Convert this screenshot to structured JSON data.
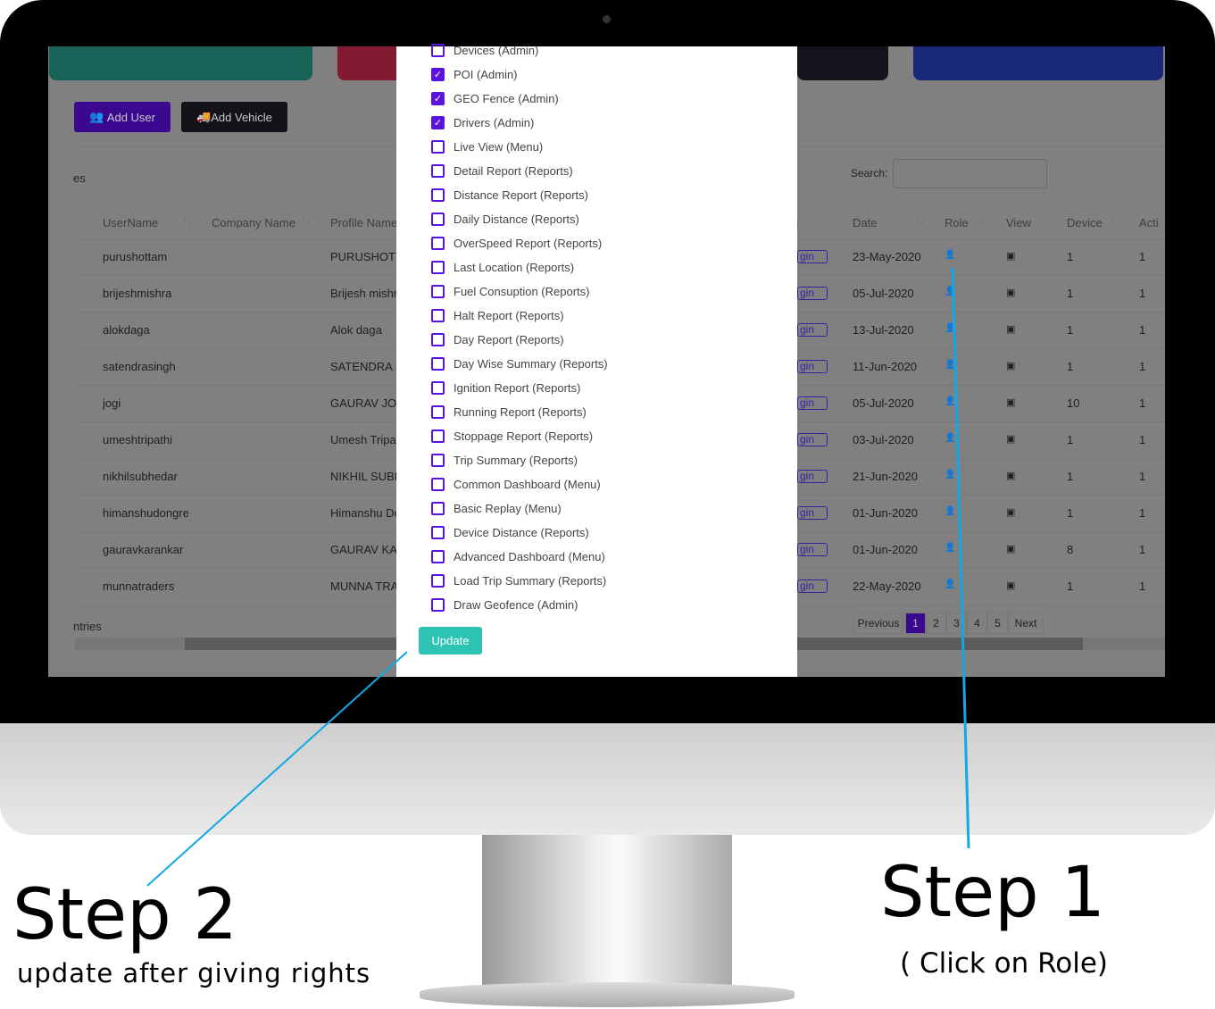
{
  "actions": {
    "add_user": "Add User",
    "add_vehicle": "Add Vehicle"
  },
  "table": {
    "entries_fragment_top": "es",
    "entries_fragment_bottom": "ntries",
    "search_label": "Search:",
    "search_value": "",
    "columns": [
      "UserName",
      "Company Name",
      "Profile Name",
      "n",
      "Date",
      "Role",
      "View",
      "Device",
      "Acti"
    ],
    "rows": [
      {
        "user": "purushottam",
        "company": "",
        "profile": "PURUSHOTT",
        "login": "gin",
        "date": "23-May-2020",
        "device": "1",
        "active": "1"
      },
      {
        "user": "brijeshmishra",
        "company": "",
        "profile": "Brijesh mishra",
        "login": "gin",
        "date": "05-Jul-2020",
        "device": "1",
        "active": "1"
      },
      {
        "user": "alokdaga",
        "company": "",
        "profile": "Alok daga",
        "login": "gin",
        "date": "13-Jul-2020",
        "device": "1",
        "active": "1"
      },
      {
        "user": "satendrasingh",
        "company": "",
        "profile": "SATENDRA S",
        "login": "gin",
        "date": "11-Jun-2020",
        "device": "1",
        "active": "1"
      },
      {
        "user": "jogi",
        "company": "",
        "profile": "GAURAV JO",
        "login": "gin",
        "date": "05-Jul-2020",
        "device": "10",
        "active": "1"
      },
      {
        "user": "umeshtripathi",
        "company": "",
        "profile": "Umesh Tripat",
        "login": "gin",
        "date": "03-Jul-2020",
        "device": "1",
        "active": "1"
      },
      {
        "user": "nikhilsubhedar",
        "company": "",
        "profile": "NIKHIL SUBE",
        "login": "gin",
        "date": "21-Jun-2020",
        "device": "1",
        "active": "1"
      },
      {
        "user": "himanshudongre",
        "company": "",
        "profile": "Himanshu Do",
        "login": "gin",
        "date": "01-Jun-2020",
        "device": "1",
        "active": "1"
      },
      {
        "user": "gauravkarankar",
        "company": "",
        "profile": "GAURAV KA",
        "login": "gin",
        "date": "01-Jun-2020",
        "device": "8",
        "active": "1"
      },
      {
        "user": "munnatraders",
        "company": "",
        "profile": "MUNNA TRA",
        "login": "gin",
        "date": "22-May-2020",
        "device": "1",
        "active": "1"
      }
    ],
    "pagination": {
      "previous": "Previous",
      "pages": [
        "1",
        "2",
        "3",
        "4",
        "5"
      ],
      "current": "1",
      "next": "Next"
    }
  },
  "modal": {
    "options": [
      {
        "label": "Devices (Admin)",
        "checked": false
      },
      {
        "label": "POI (Admin)",
        "checked": true
      },
      {
        "label": "GEO Fence (Admin)",
        "checked": true
      },
      {
        "label": "Drivers (Admin)",
        "checked": true
      },
      {
        "label": "Live View (Menu)",
        "checked": false
      },
      {
        "label": "Detail Report (Reports)",
        "checked": false
      },
      {
        "label": "Distance Report (Reports)",
        "checked": false
      },
      {
        "label": "Daily Distance (Reports)",
        "checked": false
      },
      {
        "label": "OverSpeed Report (Reports)",
        "checked": false
      },
      {
        "label": "Last Location (Reports)",
        "checked": false
      },
      {
        "label": "Fuel Consuption (Reports)",
        "checked": false
      },
      {
        "label": "Halt Report (Reports)",
        "checked": false
      },
      {
        "label": "Day Report (Reports)",
        "checked": false
      },
      {
        "label": "Day Wise Summary (Reports)",
        "checked": false
      },
      {
        "label": "Ignition Report (Reports)",
        "checked": false
      },
      {
        "label": "Running Report (Reports)",
        "checked": false
      },
      {
        "label": "Stoppage Report (Reports)",
        "checked": false
      },
      {
        "label": "Trip Summary (Reports)",
        "checked": false
      },
      {
        "label": "Common Dashboard (Menu)",
        "checked": false
      },
      {
        "label": "Basic Replay (Menu)",
        "checked": false
      },
      {
        "label": "Device Distance (Reports)",
        "checked": false
      },
      {
        "label": "Advanced Dashboard (Menu)",
        "checked": false
      },
      {
        "label": "Load Trip Summary (Reports)",
        "checked": false
      },
      {
        "label": "Draw Geofence (Admin)",
        "checked": false
      }
    ],
    "update_label": "Update"
  },
  "annotations": {
    "step2_title": "Step 2",
    "step2_text": "update after giving rights",
    "step1_title": "Step 1",
    "step1_text": "( Click on Role)"
  },
  "colors": {
    "accent": "#5b14e0",
    "update": "#2ec4b4",
    "callout_line": "#12a8e8"
  }
}
